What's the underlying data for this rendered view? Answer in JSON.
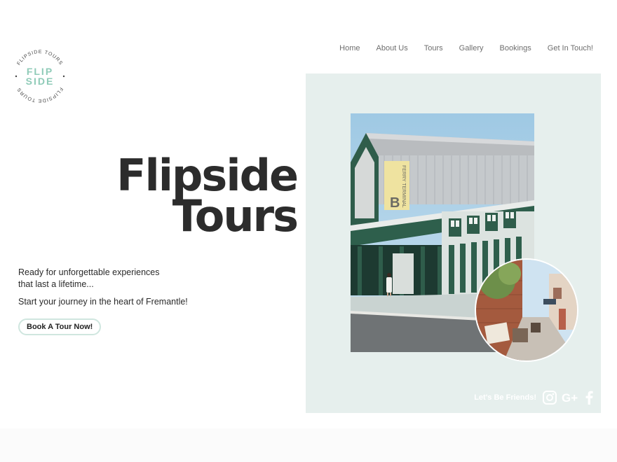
{
  "logo": {
    "ring_text": "FLIPSIDE TOURS",
    "word_top": "FLIP",
    "word_bottom": "SIDE",
    "accent_color": "#8fcbb8"
  },
  "nav": {
    "items": [
      "Home",
      "About Us",
      "Tours",
      "Gallery",
      "Bookings",
      "Get In Touch!"
    ]
  },
  "hero": {
    "title_line1": "Flipside",
    "title_line2": "Tours",
    "intro_line1": "Ready for unforgettable experiences",
    "intro_line2": "that last a lifetime...",
    "intro_line3": "Start your journey in the heart of Fremantle!",
    "cta_label": "Book A Tour Now!"
  },
  "panel": {
    "background": "#e6efed",
    "sign_text": "FERRY TERMINAL",
    "sign_letter": "B"
  },
  "social": {
    "label": "Let's Be Friends!",
    "icons": [
      "instagram-icon",
      "google-plus-icon",
      "facebook-icon"
    ]
  }
}
